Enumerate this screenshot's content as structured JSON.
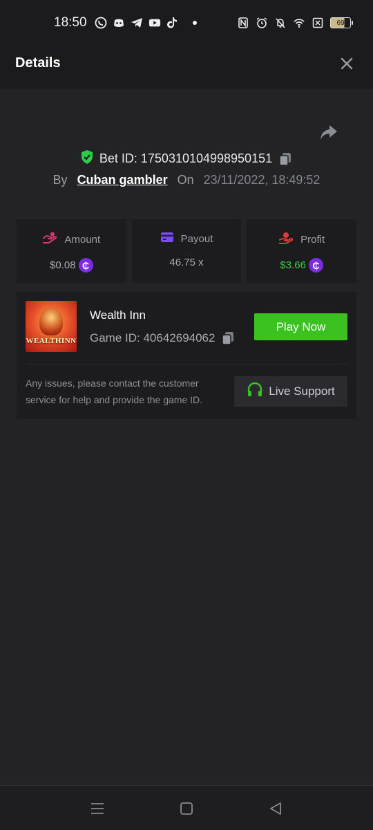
{
  "status_bar": {
    "time": "18:50",
    "battery": "69",
    "left_icons": [
      "whatsapp-icon",
      "discord-icon",
      "telegram-icon",
      "youtube-icon",
      "tiktok-icon"
    ],
    "right_icons": [
      "nfc-icon",
      "alarm-icon",
      "bell-off-icon",
      "wifi-icon",
      "sim-off-icon",
      "battery-icon"
    ]
  },
  "header": {
    "title": "Details"
  },
  "bet": {
    "id_label": "Bet ID: 1750310104998950151",
    "by_label": "By",
    "username": "Cuban gambler",
    "on_label": "On",
    "date": "23/11/2022, 18:49:52"
  },
  "stats": {
    "amount": {
      "label": "Amount",
      "value": "$0.08"
    },
    "payout": {
      "label": "Payout",
      "value": "46.75 x"
    },
    "profit": {
      "label": "Profit",
      "value": "$3.66"
    },
    "coin_symbol": "₵"
  },
  "game": {
    "name": "Wealth Inn",
    "id_label": "Game ID: 40642694062",
    "thumb_text": "WEALTHINN",
    "play_label": "Play Now",
    "issue_text": "Any issues, please contact the customer service for help and provide the game ID.",
    "support_label": "Live Support"
  },
  "colors": {
    "background": "#232326",
    "panel": "#1c1c1f",
    "accent_green": "#3bc221",
    "coin_purple": "#7d2be0",
    "verified_green": "#2fcb4b",
    "amount_pink": "#e0356f",
    "payout_purple": "#7b4ee8",
    "profit_red": "#e03a3a"
  }
}
